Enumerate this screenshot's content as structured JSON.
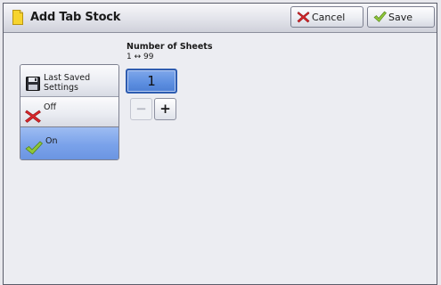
{
  "header": {
    "title": "Add Tab Stock",
    "cancel_label": "Cancel",
    "save_label": "Save"
  },
  "sheets": {
    "label": "Number of Sheets",
    "range": "1 ↔ 99",
    "value": "1",
    "decrement_symbol": "−",
    "increment_symbol": "+"
  },
  "options": {
    "last_saved": "Last Saved Settings",
    "off": "Off",
    "on": "On"
  },
  "colors": {
    "accent_selected": "#7aa2ea",
    "value_box": "#5c8ee0",
    "doc_icon": "#f7d42e",
    "cancel_icon": "#d9262b",
    "save_icon": "#8fc63a"
  }
}
